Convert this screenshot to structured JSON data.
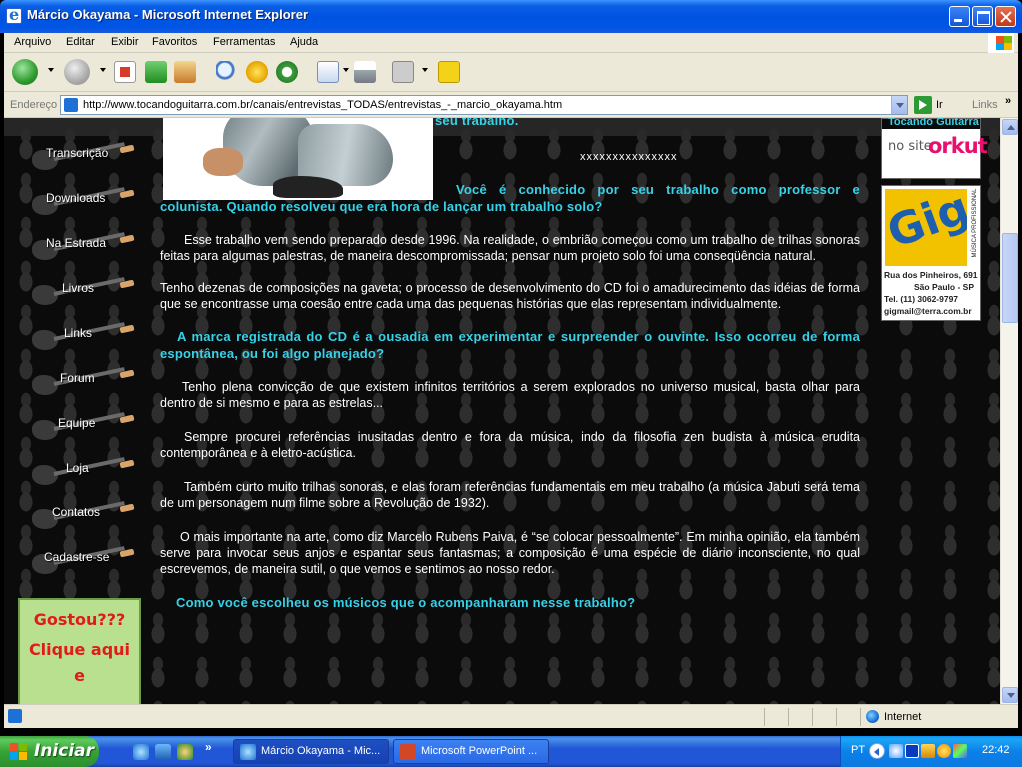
{
  "window": {
    "title": "Márcio Okayama - Microsoft Internet Explorer"
  },
  "menu": {
    "items": [
      "Arquivo",
      "Editar",
      "Exibir",
      "Favoritos",
      "Ferramentas",
      "Ajuda"
    ]
  },
  "toolbar": {
    "icons": [
      "back-icon",
      "forward-icon",
      "stop-icon",
      "refresh-icon",
      "home-icon",
      "search-icon",
      "favorites-icon",
      "history-icon",
      "mail-icon",
      "print-icon",
      "edit-icon",
      "messenger-icon"
    ]
  },
  "address": {
    "label": "Endereço",
    "url": "http://www.tocandoguitarra.com.br/canais/entrevistas_TODAS/entrevistas_-_marcio_okayama.htm",
    "go_label": "Ir",
    "links_label": "Links",
    "more": "»"
  },
  "nav": {
    "items": [
      "Transcrição",
      "Downloads",
      "Na Estrada",
      "Livros",
      "Links",
      "Forum",
      "Equipe",
      "Loja",
      "Contatos",
      "Cadastre-se"
    ]
  },
  "promo": {
    "line1": "Gostou???",
    "line2": "Clique aqui",
    "line3": "e"
  },
  "article": {
    "partial_heading": "seu trabalho.",
    "separator": "xxxxxxxxxxxxxxx",
    "q1": "Você é conhecido por seu trabalho como professor e colunista. Quando resolveu que era hora de lançar um trabalho solo?",
    "a1": "Esse trabalho vem sendo preparado desde 1996. Na realidade, o embrião começou como um trabalho de trilhas sonoras feitas para algumas palestras, de maneira descompromissada; pensar num  projeto solo foi uma conseqüência natural.",
    "a1b": "Tenho dezenas de composições na gaveta; o processo de desenvolvimento do CD  foi o amadurecimento das idéias de forma que se encontrasse uma coesão entre cada uma das pequenas histórias que elas representam individualmente.",
    "q2": "A marca registrada do CD é a ousadia em experimentar e surpreender o ouvinte. Isso ocorreu de forma espontânea, ou foi algo planejado?",
    "a2": "Tenho plena convicção de que existem infinitos territórios a serem explorados no universo musical, basta olhar para dentro de si mesmo e para as estrelas...",
    "a2b": "Sempre procurei referências inusitadas dentro e fora da música, indo da filosofia zen budista  à música erudita contemporânea e à eletro-acústica.",
    "a2c": "Também curto muito trilhas sonoras, e elas foram referências fundamentais em meu trabalho (a música Jabuti será tema de um personagem num filme sobre a Revolução de 1932).",
    "a2d": "O mais importante na arte, como diz Marcelo Rubens Paiva,  é “se colocar pessoalmente”. Em minha opinião, ela também serve para invocar seus anjos e espantar seus fantasmas; a composição é uma espécie de diário inconsciente, no qual escrevemos, de maneira sutil, o que vemos e sentimos ao nosso redor.",
    "q3": "Como você escolheu os músicos que o acompanharam nesse trabalho?"
  },
  "banners": {
    "orkut": {
      "brand": "Tocando Guitarra",
      "site": "no site",
      "name": "orkut"
    },
    "gig": {
      "vertical": "MÚSICA PROFISSIONAL",
      "addr1": "Rua dos Pinheiros, 691",
      "addr2": "São Paulo - SP",
      "phone": "Tel. (11) 3062-9797",
      "email": "gigmail@terra.com.br"
    }
  },
  "status": {
    "zone": "Internet"
  },
  "taskbar": {
    "start": "Iniciar",
    "more": "»",
    "tasks": [
      "Márcio Okayama - Mic...",
      "Microsoft PowerPoint ..."
    ],
    "lang": "PT",
    "clock": "22:42"
  },
  "colors": {
    "question": "#37d1e8",
    "answer": "#ffffff",
    "page_bg": "#0b0b0b",
    "promo_text": "#e11b1b"
  }
}
